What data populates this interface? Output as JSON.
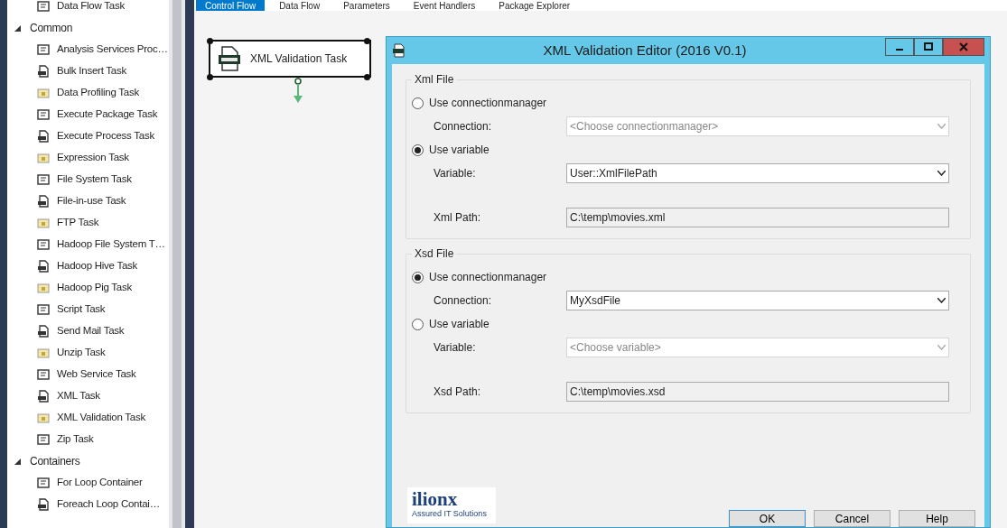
{
  "toolbox": {
    "top_item": {
      "label": "Data Flow Task"
    },
    "groups": [
      {
        "label": "Common",
        "expanded": true,
        "items": [
          {
            "label": "Analysis Services Proc…"
          },
          {
            "label": "Bulk Insert Task"
          },
          {
            "label": "Data Profiling Task"
          },
          {
            "label": "Execute Package Task"
          },
          {
            "label": "Execute Process Task"
          },
          {
            "label": "Expression Task"
          },
          {
            "label": "File System Task"
          },
          {
            "label": "File-in-use Task"
          },
          {
            "label": "FTP Task"
          },
          {
            "label": "Hadoop File System T…"
          },
          {
            "label": "Hadoop Hive Task"
          },
          {
            "label": "Hadoop Pig Task"
          },
          {
            "label": "Script Task"
          },
          {
            "label": "Send Mail Task"
          },
          {
            "label": "Unzip Task"
          },
          {
            "label": "Web Service Task"
          },
          {
            "label": "XML Task"
          },
          {
            "label": "XML Validation Task"
          },
          {
            "label": "Zip Task"
          }
        ]
      },
      {
        "label": "Containers",
        "expanded": true,
        "items": [
          {
            "label": "For Loop Container"
          },
          {
            "label": "Foreach Loop Contai…"
          }
        ]
      }
    ]
  },
  "designer_tabs": [
    {
      "label": "Control Flow",
      "selected": true
    },
    {
      "label": "Data Flow",
      "selected": false
    },
    {
      "label": "Parameters",
      "selected": false
    },
    {
      "label": "Event Handlers",
      "selected": false
    },
    {
      "label": "Package Explorer",
      "selected": false
    }
  ],
  "canvas": {
    "task": {
      "label": "XML Validation Task",
      "selected": true
    }
  },
  "dialog": {
    "title": "XML Validation Editor (2016 V0.1)",
    "groups": [
      {
        "label": "Xml File",
        "rows": [
          {
            "kind": "radio",
            "label": "Use connectionmanager",
            "selected": false
          },
          {
            "kind": "combo",
            "label": "Connection:",
            "placeholder": "<Choose connectionmanager>",
            "disabled": true
          },
          {
            "kind": "radio",
            "label": "Use variable",
            "selected": true
          },
          {
            "kind": "combo",
            "label": "Variable:",
            "value": "User::XmlFilePath",
            "disabled": false
          },
          {
            "kind": "text",
            "label": "Xml Path:",
            "value": "C:\\temp\\movies.xml"
          }
        ]
      },
      {
        "label": "Xsd File",
        "rows": [
          {
            "kind": "radio",
            "label": "Use connectionmanager",
            "selected": true
          },
          {
            "kind": "combo",
            "label": "Connection:",
            "value": "MyXsdFile",
            "disabled": false
          },
          {
            "kind": "radio",
            "label": "Use variable",
            "selected": false
          },
          {
            "kind": "combo",
            "label": "Variable:",
            "placeholder": "<Choose variable>",
            "disabled": true
          },
          {
            "kind": "text",
            "label": "Xsd Path:",
            "value": "C:\\temp\\movies.xsd"
          }
        ]
      }
    ],
    "logo": {
      "name": "ilionx",
      "tagline": "Assured IT Solutions"
    },
    "buttons": [
      "OK",
      "Cancel",
      "Help"
    ]
  }
}
